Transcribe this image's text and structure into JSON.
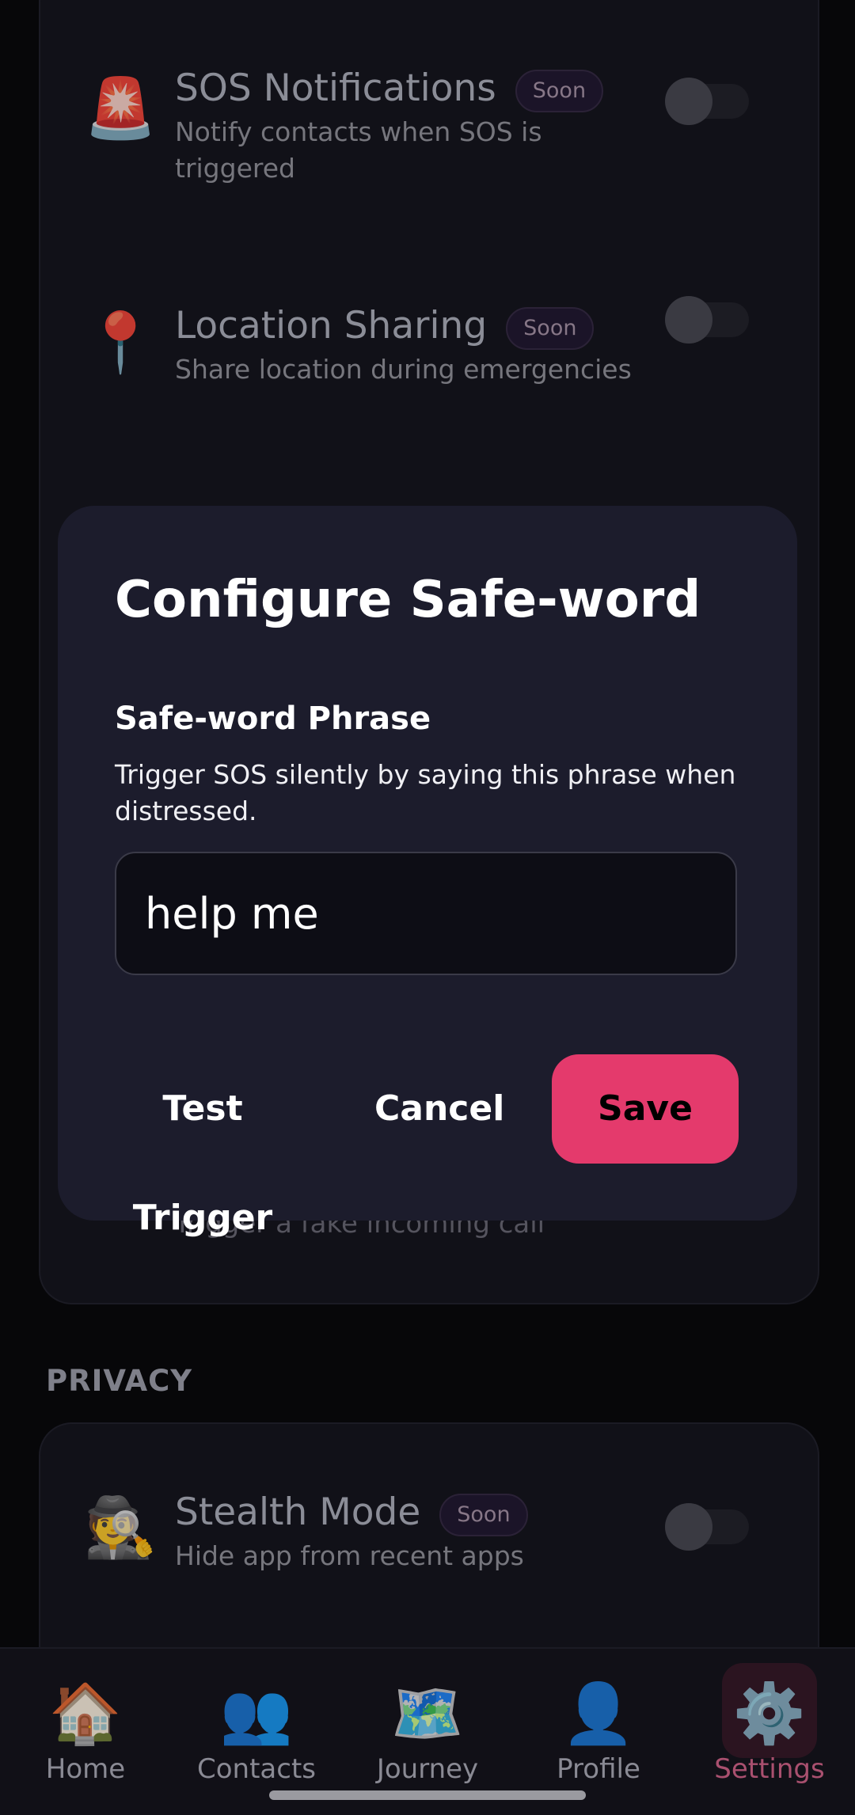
{
  "safety_settings": {
    "sos_notifications": {
      "icon": "siren-icon",
      "glyph": "🚨",
      "title": "SOS Notifications",
      "badge": "Soon",
      "description": "Notify contacts when SOS is triggered"
    },
    "location_sharing": {
      "icon": "pushpin-icon",
      "glyph": "📍",
      "title": "Location Sharing",
      "badge": "Soon",
      "description": "Share location during emergencies"
    },
    "fake_call_partial_description": "Trigger a fake incoming call"
  },
  "privacy": {
    "section_label": "PRIVACY",
    "stealth_mode": {
      "icon": "detective-icon",
      "glyph": "🕵",
      "title": "Stealth Mode",
      "badge": "Soon",
      "description": "Hide app from recent apps"
    }
  },
  "dialog": {
    "title": "Configure Safe-word",
    "field_label": "Safe-word Phrase",
    "field_help": "Trigger SOS silently by saying this phrase when distressed.",
    "field_value": "help me",
    "buttons": {
      "test": "Test Trigger",
      "cancel": "Cancel",
      "save": "Save"
    },
    "accent_color": "#e43a6c"
  },
  "nav": {
    "items": [
      {
        "label": "Home",
        "icon": "house-icon",
        "glyph": "🏠"
      },
      {
        "label": "Contacts",
        "icon": "people-icon",
        "glyph": "👥"
      },
      {
        "label": "Journey",
        "icon": "map-icon",
        "glyph": "🗺️"
      },
      {
        "label": "Profile",
        "icon": "person-icon",
        "glyph": "👤"
      },
      {
        "label": "Settings",
        "icon": "gear-icon",
        "glyph": "⚙️",
        "active": true
      }
    ]
  }
}
